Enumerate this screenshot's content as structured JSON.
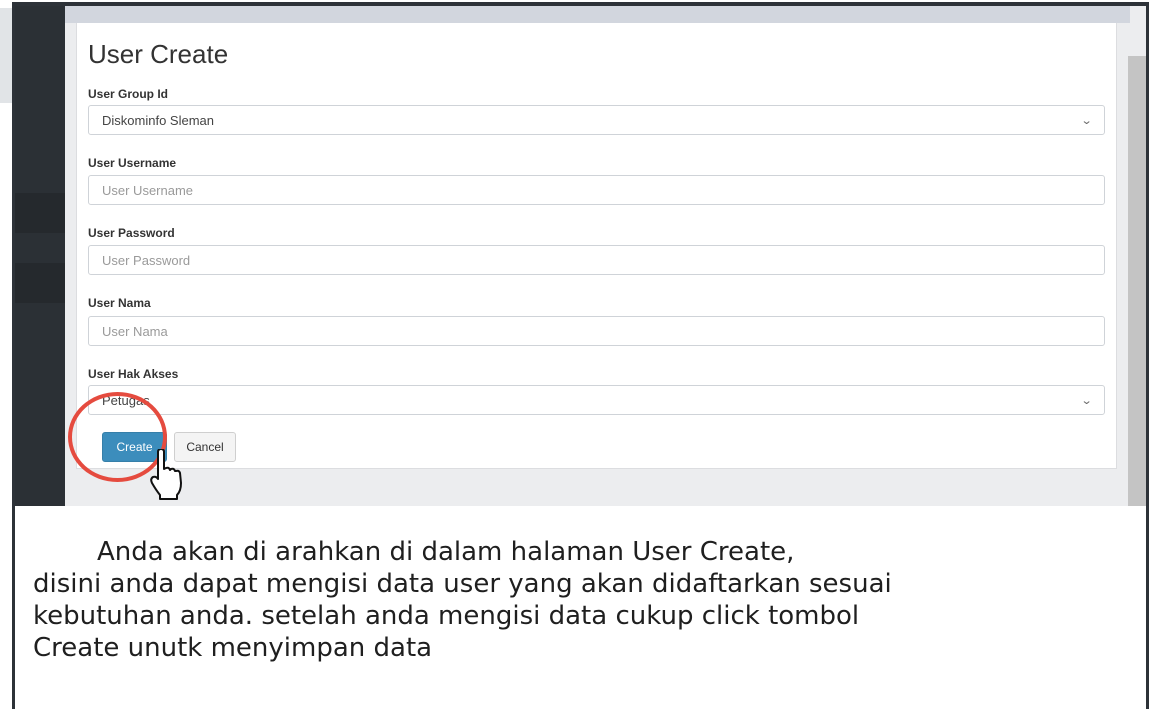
{
  "page": {
    "title": "User Create"
  },
  "form": {
    "group": {
      "label": "User Group Id",
      "value": "Diskominfo Sleman"
    },
    "username": {
      "label": "User Username",
      "placeholder": "User Username"
    },
    "password": {
      "label": "User Password",
      "placeholder": "User Password"
    },
    "nama": {
      "label": "User Nama",
      "placeholder": "User Nama"
    },
    "akses": {
      "label": "User Hak Akses",
      "value": "Petugas"
    }
  },
  "buttons": {
    "create": "Create",
    "cancel": "Cancel"
  },
  "caption": {
    "line1": "Anda akan di arahkan di dalam halaman User Create,",
    "line2": "disini anda dapat mengisi data user yang akan didaftarkan sesuai",
    "line3": "kebutuhan anda. setelah anda mengisi data cukup click tombol",
    "line4": "Create unutk menyimpan data"
  },
  "colors": {
    "primary": "#3c8dbc",
    "highlight": "#e54b3f",
    "sidebar": "#2b3035"
  },
  "icons": {
    "select_arrow": "chevron-down-icon",
    "pointer": "hand-pointer-cursor-icon"
  }
}
